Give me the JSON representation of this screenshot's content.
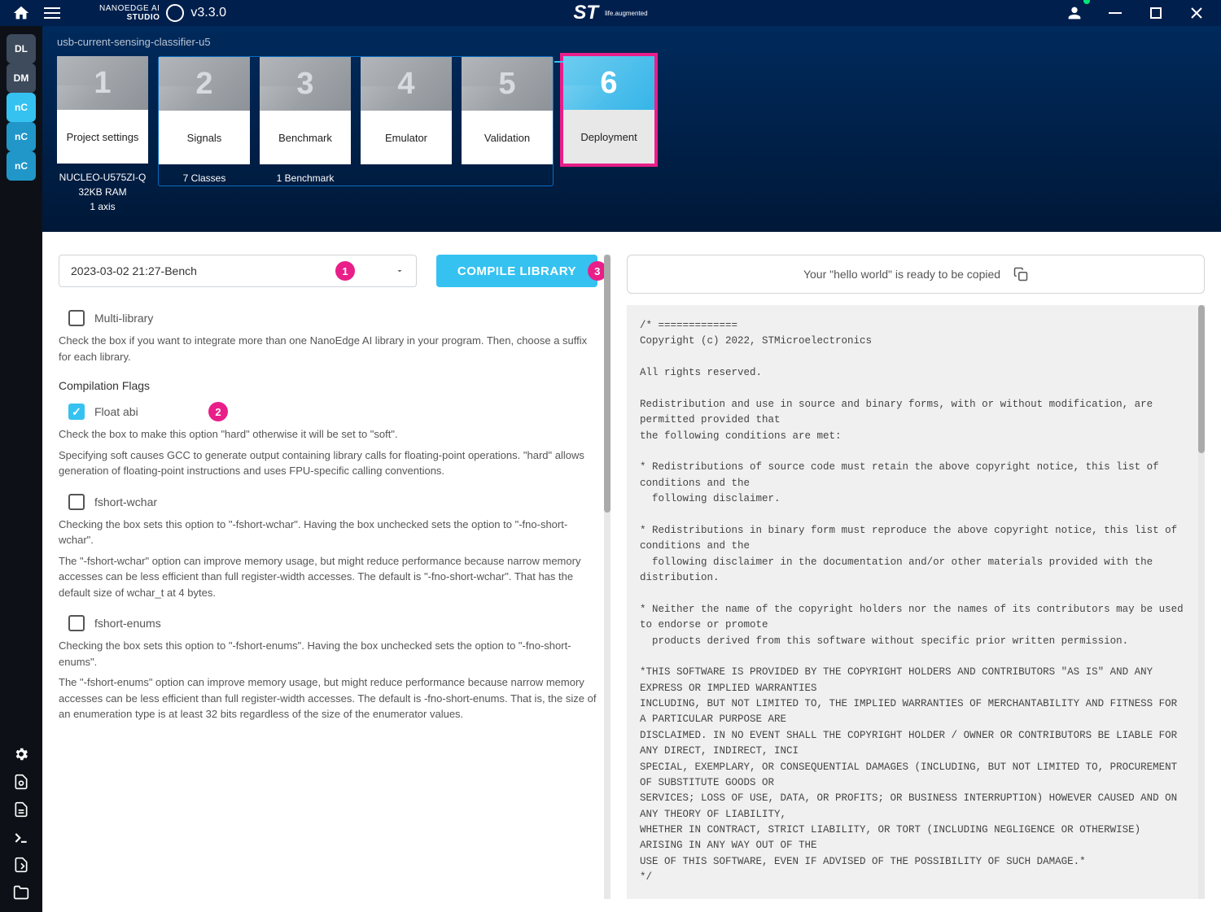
{
  "app": {
    "name_top": "NANOEDGE AI",
    "name_bot": "STUDIO",
    "version": "v3.3.0",
    "brand": "ST",
    "brand_sub": "life.augmented"
  },
  "project": {
    "name": "usb-current-sensing-classifier-u5"
  },
  "sidebar": {
    "items": [
      {
        "label": "DL",
        "cls": "dl"
      },
      {
        "label": "DM",
        "cls": "dm"
      },
      {
        "label": "nC",
        "cls": "nc active"
      },
      {
        "label": "nC",
        "cls": "nc"
      },
      {
        "label": "nC",
        "cls": "nc"
      }
    ]
  },
  "steps": [
    {
      "num": "1",
      "label": "Project settings",
      "meta": "NUCLEO-U575ZI-Q\n32KB RAM\n1 axis"
    },
    {
      "num": "2",
      "label": "Signals",
      "meta": "7 Classes"
    },
    {
      "num": "3",
      "label": "Benchmark",
      "meta": "1 Benchmark"
    },
    {
      "num": "4",
      "label": "Emulator",
      "meta": ""
    },
    {
      "num": "5",
      "label": "Validation",
      "meta": ""
    },
    {
      "num": "6",
      "label": "Deployment",
      "meta": "",
      "active": true
    }
  ],
  "form": {
    "bench_value": "2023-03-02 21:27-Bench",
    "compile_btn": "COMPILE LIBRARY",
    "multi_library": {
      "label": "Multi-library",
      "checked": false
    },
    "multi_library_help": "Check the box if you want to integrate more than one NanoEdge AI library in your program. Then, choose a suffix for each library.",
    "comp_flags_title": "Compilation Flags",
    "float_abi": {
      "label": "Float abi",
      "checked": true
    },
    "float_abi_help1": "Check the box to make this option \"hard\" otherwise it will be set to \"soft\".",
    "float_abi_help2": "Specifying soft causes GCC to generate output containing library calls for floating-point operations. \"hard\" allows generation of floating-point instructions and uses FPU-specific calling conventions.",
    "fshort_wchar": {
      "label": "fshort-wchar",
      "checked": false
    },
    "fshort_wchar_help1": "Checking the box sets this option to \"-fshort-wchar\". Having the box unchecked sets the option to \"-fno-short-wchar\".",
    "fshort_wchar_help2": "The \"-fshort-wchar\" option can improve memory usage, but might reduce performance because narrow memory accesses can be less efficient than full register-width accesses. The default is \"-fno-short-wchar\". That has the default size of wchar_t at 4 bytes.",
    "fshort_enums": {
      "label": "fshort-enums",
      "checked": false
    },
    "fshort_enums_help1": "Checking the box sets this option to \"-fshort-enums\". Having the box unchecked sets the option to \"-fno-short-enums\".",
    "fshort_enums_help2": "The \"-fshort-enums\" option can improve memory usage, but might reduce performance because narrow memory accesses can be less efficient than full register-width accesses. The default is -fno-short-enums. That is, the size of an enumeration type is at least 32 bits regardless of the size of the enumerator values."
  },
  "code_panel": {
    "copy_msg": "Your \"hello world\" is ready to be copied",
    "code": "/* =============\nCopyright (c) 2022, STMicroelectronics\n\nAll rights reserved.\n\nRedistribution and use in source and binary forms, with or without modification, are permitted provided that\nthe following conditions are met:\n\n* Redistributions of source code must retain the above copyright notice, this list of conditions and the \n  following disclaimer.\n\n* Redistributions in binary form must reproduce the above copyright notice, this list of conditions and the \n  following disclaimer in the documentation and/or other materials provided with the distribution.\n\n* Neither the name of the copyright holders nor the names of its contributors may be used to endorse or promote \n  products derived from this software without specific prior written permission.\n\n*THIS SOFTWARE IS PROVIDED BY THE COPYRIGHT HOLDERS AND CONTRIBUTORS \"AS IS\" AND ANY EXPRESS OR IMPLIED WARRANTIES \nINCLUDING, BUT NOT LIMITED TO, THE IMPLIED WARRANTIES OF MERCHANTABILITY AND FITNESS FOR A PARTICULAR PURPOSE ARE \nDISCLAIMED. IN NO EVENT SHALL THE COPYRIGHT HOLDER / OWNER OR CONTRIBUTORS BE LIABLE FOR ANY DIRECT, INDIRECT, INCI\nSPECIAL, EXEMPLARY, OR CONSEQUENTIAL DAMAGES (INCLUDING, BUT NOT LIMITED TO, PROCUREMENT OF SUBSTITUTE GOODS OR \nSERVICES; LOSS OF USE, DATA, OR PROFITS; OR BUSINESS INTERRUPTION) HOWEVER CAUSED AND ON ANY THEORY OF LIABILITY, \nWHETHER IN CONTRACT, STRICT LIABILITY, OR TORT (INCLUDING NEGLIGENCE OR OTHERWISE) ARISING IN ANY WAY OUT OF THE \nUSE OF THIS SOFTWARE, EVEN IF ADVISED OF THE POSSIBILITY OF SUCH DAMAGE.*\n*/"
  },
  "badges": {
    "b1": "1",
    "b2": "2",
    "b3": "3"
  }
}
